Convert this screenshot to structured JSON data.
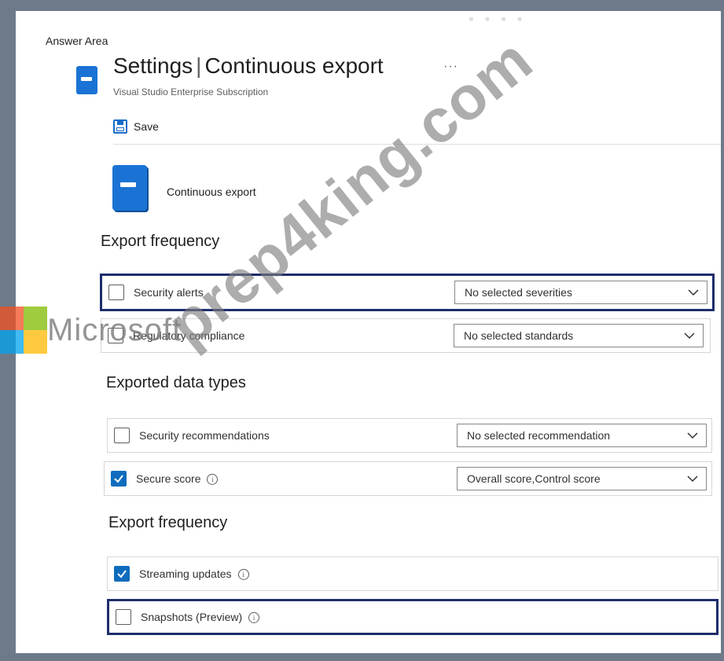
{
  "answer_area_label": "Answer Area",
  "header": {
    "title": "Settings",
    "title_suffix": "Continuous export",
    "separator": "|",
    "more": "···",
    "subtitle": "Visual Studio Enterprise Subscription"
  },
  "toolbar": {
    "save_label": "Save"
  },
  "feature": {
    "label": "Continuous export"
  },
  "sections": {
    "export_frequency_1": "Export frequency",
    "exported_data_types": "Exported data types",
    "export_frequency_2": "Export frequency"
  },
  "rows": {
    "security_alerts": {
      "label": "Security alerts",
      "checked": false,
      "dropdown": "No selected severities"
    },
    "regulatory_compliance": {
      "label": "Regulatory compliance",
      "checked": false,
      "dropdown": "No selected standards"
    },
    "security_recommendations": {
      "label": "Security recommendations",
      "checked": false,
      "dropdown": "No selected recommendation"
    },
    "secure_score": {
      "label": "Secure score",
      "checked": true,
      "dropdown": "Overall score,Control score"
    },
    "streaming_updates": {
      "label": "Streaming updates",
      "checked": true
    },
    "snapshots": {
      "label": "Snapshots (Preview)",
      "checked": false
    }
  },
  "watermark": {
    "brand": "Microsoft",
    "site": "prep4king.com"
  },
  "colors": {
    "accent": "#0f6cbd",
    "highlight_border": "#1e2d6b",
    "icon_blue": "#1a73d4",
    "backdrop": "#6e7a89"
  },
  "icons": {
    "header": "document-icon",
    "save": "save-icon",
    "feature": "continuous-export-icon",
    "info": "info-icon",
    "chevron": "chevron-down-icon"
  }
}
